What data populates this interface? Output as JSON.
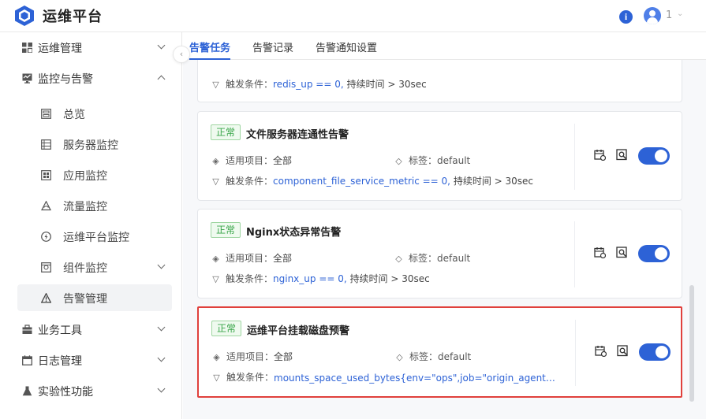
{
  "app": {
    "title": "运维平台"
  },
  "header": {
    "info_icon": "info-icon",
    "user_name": "1"
  },
  "sidebar": {
    "items": [
      {
        "label": "运维管理",
        "icon": "grid-icon",
        "level": 1,
        "expanded": false
      },
      {
        "label": "监控与告警",
        "icon": "monitor-icon",
        "level": 1,
        "expanded": true
      },
      {
        "label": "总览",
        "icon": "overview-icon",
        "level": 2
      },
      {
        "label": "服务器监控",
        "icon": "server-icon",
        "level": 2
      },
      {
        "label": "应用监控",
        "icon": "app-icon",
        "level": 2
      },
      {
        "label": "流量监控",
        "icon": "traffic-icon",
        "level": 2
      },
      {
        "label": "运维平台监控",
        "icon": "platform-icon",
        "level": 2
      },
      {
        "label": "组件监控",
        "icon": "component-icon",
        "level": 2,
        "has_children": true
      },
      {
        "label": "告警管理",
        "icon": "alert-icon",
        "level": 2,
        "active": true
      },
      {
        "label": "业务工具",
        "icon": "tool-icon",
        "level": 1,
        "expanded": false
      },
      {
        "label": "日志管理",
        "icon": "calendar-icon",
        "level": 1,
        "expanded": false
      },
      {
        "label": "实验性功能",
        "icon": "flask-icon",
        "level": 1,
        "expanded": false
      }
    ]
  },
  "tabs": [
    {
      "label": "告警任务",
      "active": true
    },
    {
      "label": "告警记录",
      "active": false
    },
    {
      "label": "告警通知设置",
      "active": false
    }
  ],
  "labels": {
    "scope": "适用项目：",
    "tag": "标签：",
    "trigger": "触发条件："
  },
  "partial_card": {
    "trigger_condition": "redis_up == 0,",
    "duration": "持续时间 > 30sec"
  },
  "alerts": [
    {
      "status": "正常",
      "title": "文件服务器连通性告警",
      "scope": "全部",
      "tag": "default",
      "trigger_condition": "component_file_service_metric == 0,",
      "duration": "持续时间 > 30sec",
      "enabled": true,
      "highlighted": false
    },
    {
      "status": "正常",
      "title": "Nginx状态异常告警",
      "scope": "全部",
      "tag": "default",
      "trigger_condition": "nginx_up == 0,",
      "duration": "持续时间 > 30sec",
      "enabled": true,
      "highlighted": false
    },
    {
      "status": "正常",
      "title": "运维平台挂载磁盘预警",
      "scope": "全部",
      "tag": "default",
      "trigger_condition": "mounts_space_used_bytes{env=\"ops\",job=\"origin_agent\"} / mount...",
      "duration": "",
      "enabled": true,
      "highlighted": true
    }
  ],
  "colors": {
    "accent": "#2d62d6",
    "status_green": "#3aa54a",
    "highlight_red": "#e0403c"
  }
}
